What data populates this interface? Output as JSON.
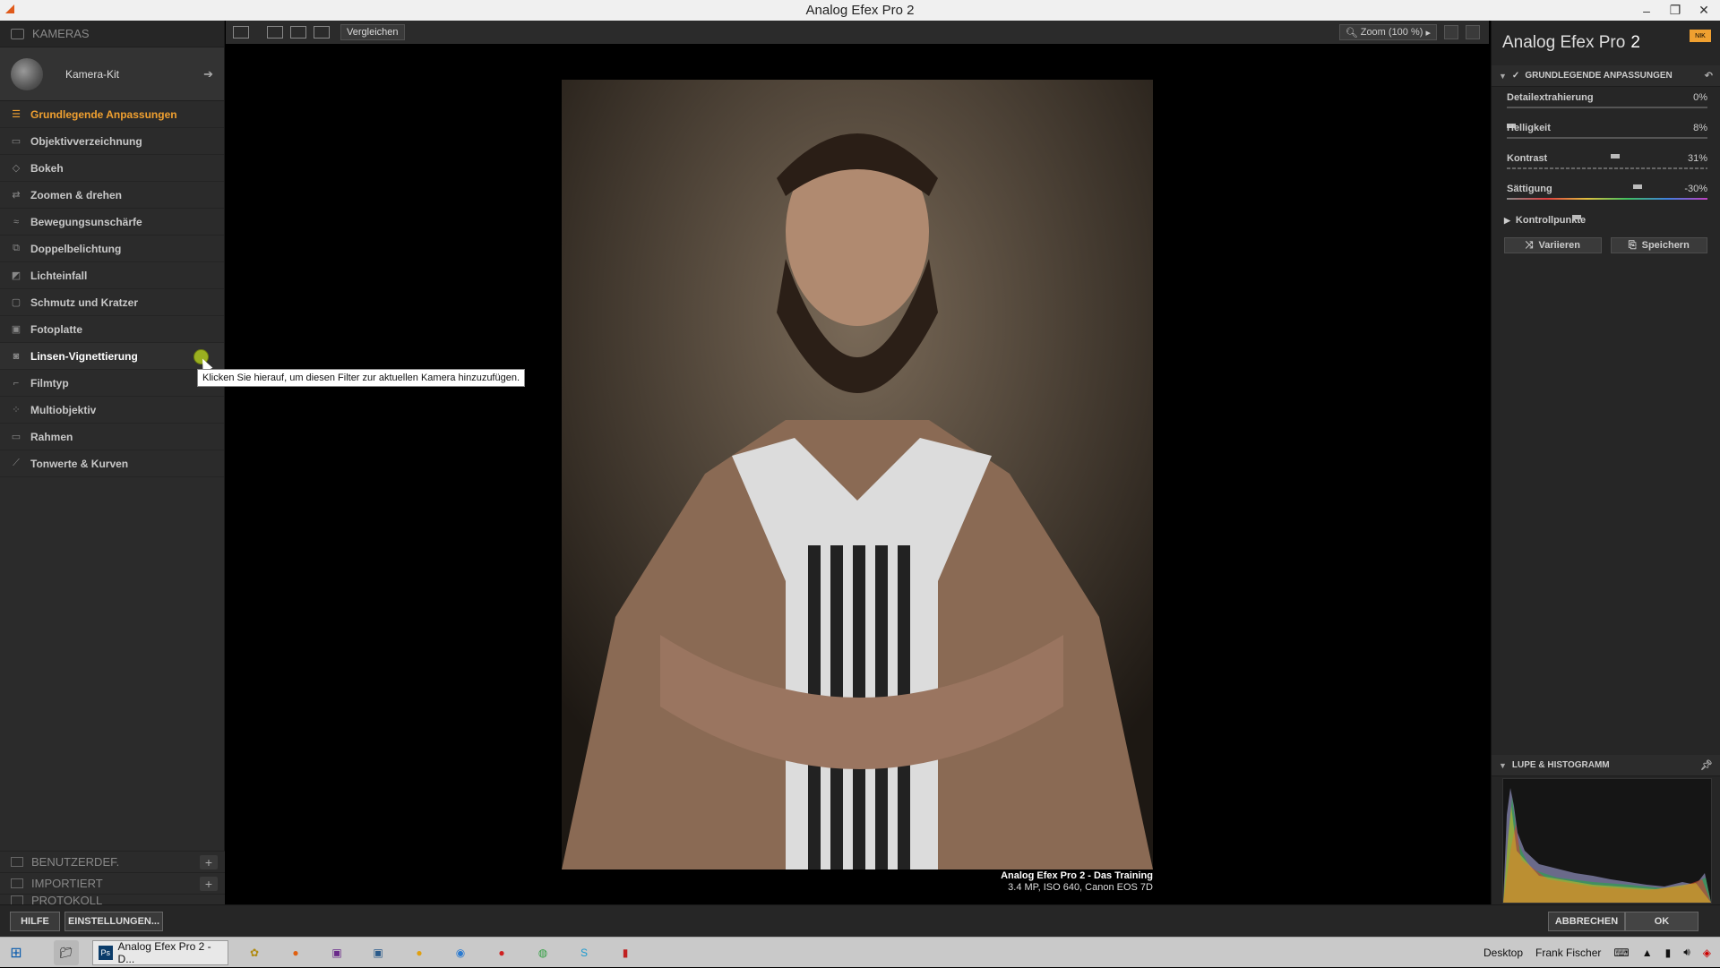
{
  "window": {
    "title": "Analog Efex Pro 2"
  },
  "left_panel": {
    "header": "KAMERAS",
    "kit_label": "Kamera-Kit",
    "filters": [
      {
        "label": "Grundlegende Anpassungen",
        "icon": "sliders-icon",
        "state": "active"
      },
      {
        "label": "Objektivverzeichnung",
        "icon": "lens-distortion-icon"
      },
      {
        "label": "Bokeh",
        "icon": "bokeh-icon"
      },
      {
        "label": "Zoomen & drehen",
        "icon": "rotate-icon"
      },
      {
        "label": "Bewegungsunschärfe",
        "icon": "motion-blur-icon"
      },
      {
        "label": "Doppelbelichtung",
        "icon": "double-exposure-icon"
      },
      {
        "label": "Lichteinfall",
        "icon": "light-leak-icon"
      },
      {
        "label": "Schmutz und Kratzer",
        "icon": "dirt-icon"
      },
      {
        "label": "Fotoplatte",
        "icon": "photo-plate-icon"
      },
      {
        "label": "Linsen-Vignettierung",
        "icon": "vignette-icon",
        "state": "hover"
      },
      {
        "label": "Filmtyp",
        "icon": "film-icon"
      },
      {
        "label": "Multiobjektiv",
        "icon": "multilens-icon"
      },
      {
        "label": "Rahmen",
        "icon": "frame-icon"
      },
      {
        "label": "Tonwerte & Kurven",
        "icon": "curves-icon"
      }
    ],
    "tooltip": "Klicken Sie hierauf, um diesen Filter zur aktuellen Kamera hinzuzufügen.",
    "bottom_sections": [
      "BENUTZERDEF.",
      "IMPORTIERT",
      "PROTOKOLL"
    ]
  },
  "toolbar": {
    "compare_label": "Vergleichen",
    "zoom_label": "Zoom (100 %)"
  },
  "image": {
    "caption_title": "Analog Efex Pro 2 - Das Training",
    "caption_meta": "3.4 MP, ISO 640, Canon EOS 7D"
  },
  "right_panel": {
    "brand": "Analog Efex Pro",
    "brand_version": "2",
    "section_title": "GRUNDLEGENDE ANPASSUNGEN",
    "sliders": [
      {
        "label": "Detailextrahierung",
        "value": "0%",
        "fraction": 0.0
      },
      {
        "label": "Helligkeit",
        "value": "8%",
        "fraction": 0.54
      },
      {
        "label": "Kontrast",
        "value": "31%",
        "fraction": 0.65
      },
      {
        "label": "Sättigung",
        "value": "-30%",
        "fraction": 0.35
      }
    ],
    "control_points": "Kontrollpunkte",
    "vary_label": "Variieren",
    "save_label": "Speichern",
    "histogram_title": "LUPE & HISTOGRAMM"
  },
  "bottom_bar": {
    "help": "HILFE",
    "settings": "EINSTELLUNGEN...",
    "cancel": "ABBRECHEN",
    "ok": "OK"
  },
  "taskbar": {
    "active_app": "Analog Efex Pro 2 - D...",
    "desktop": "Desktop",
    "user": "Frank Fischer"
  }
}
